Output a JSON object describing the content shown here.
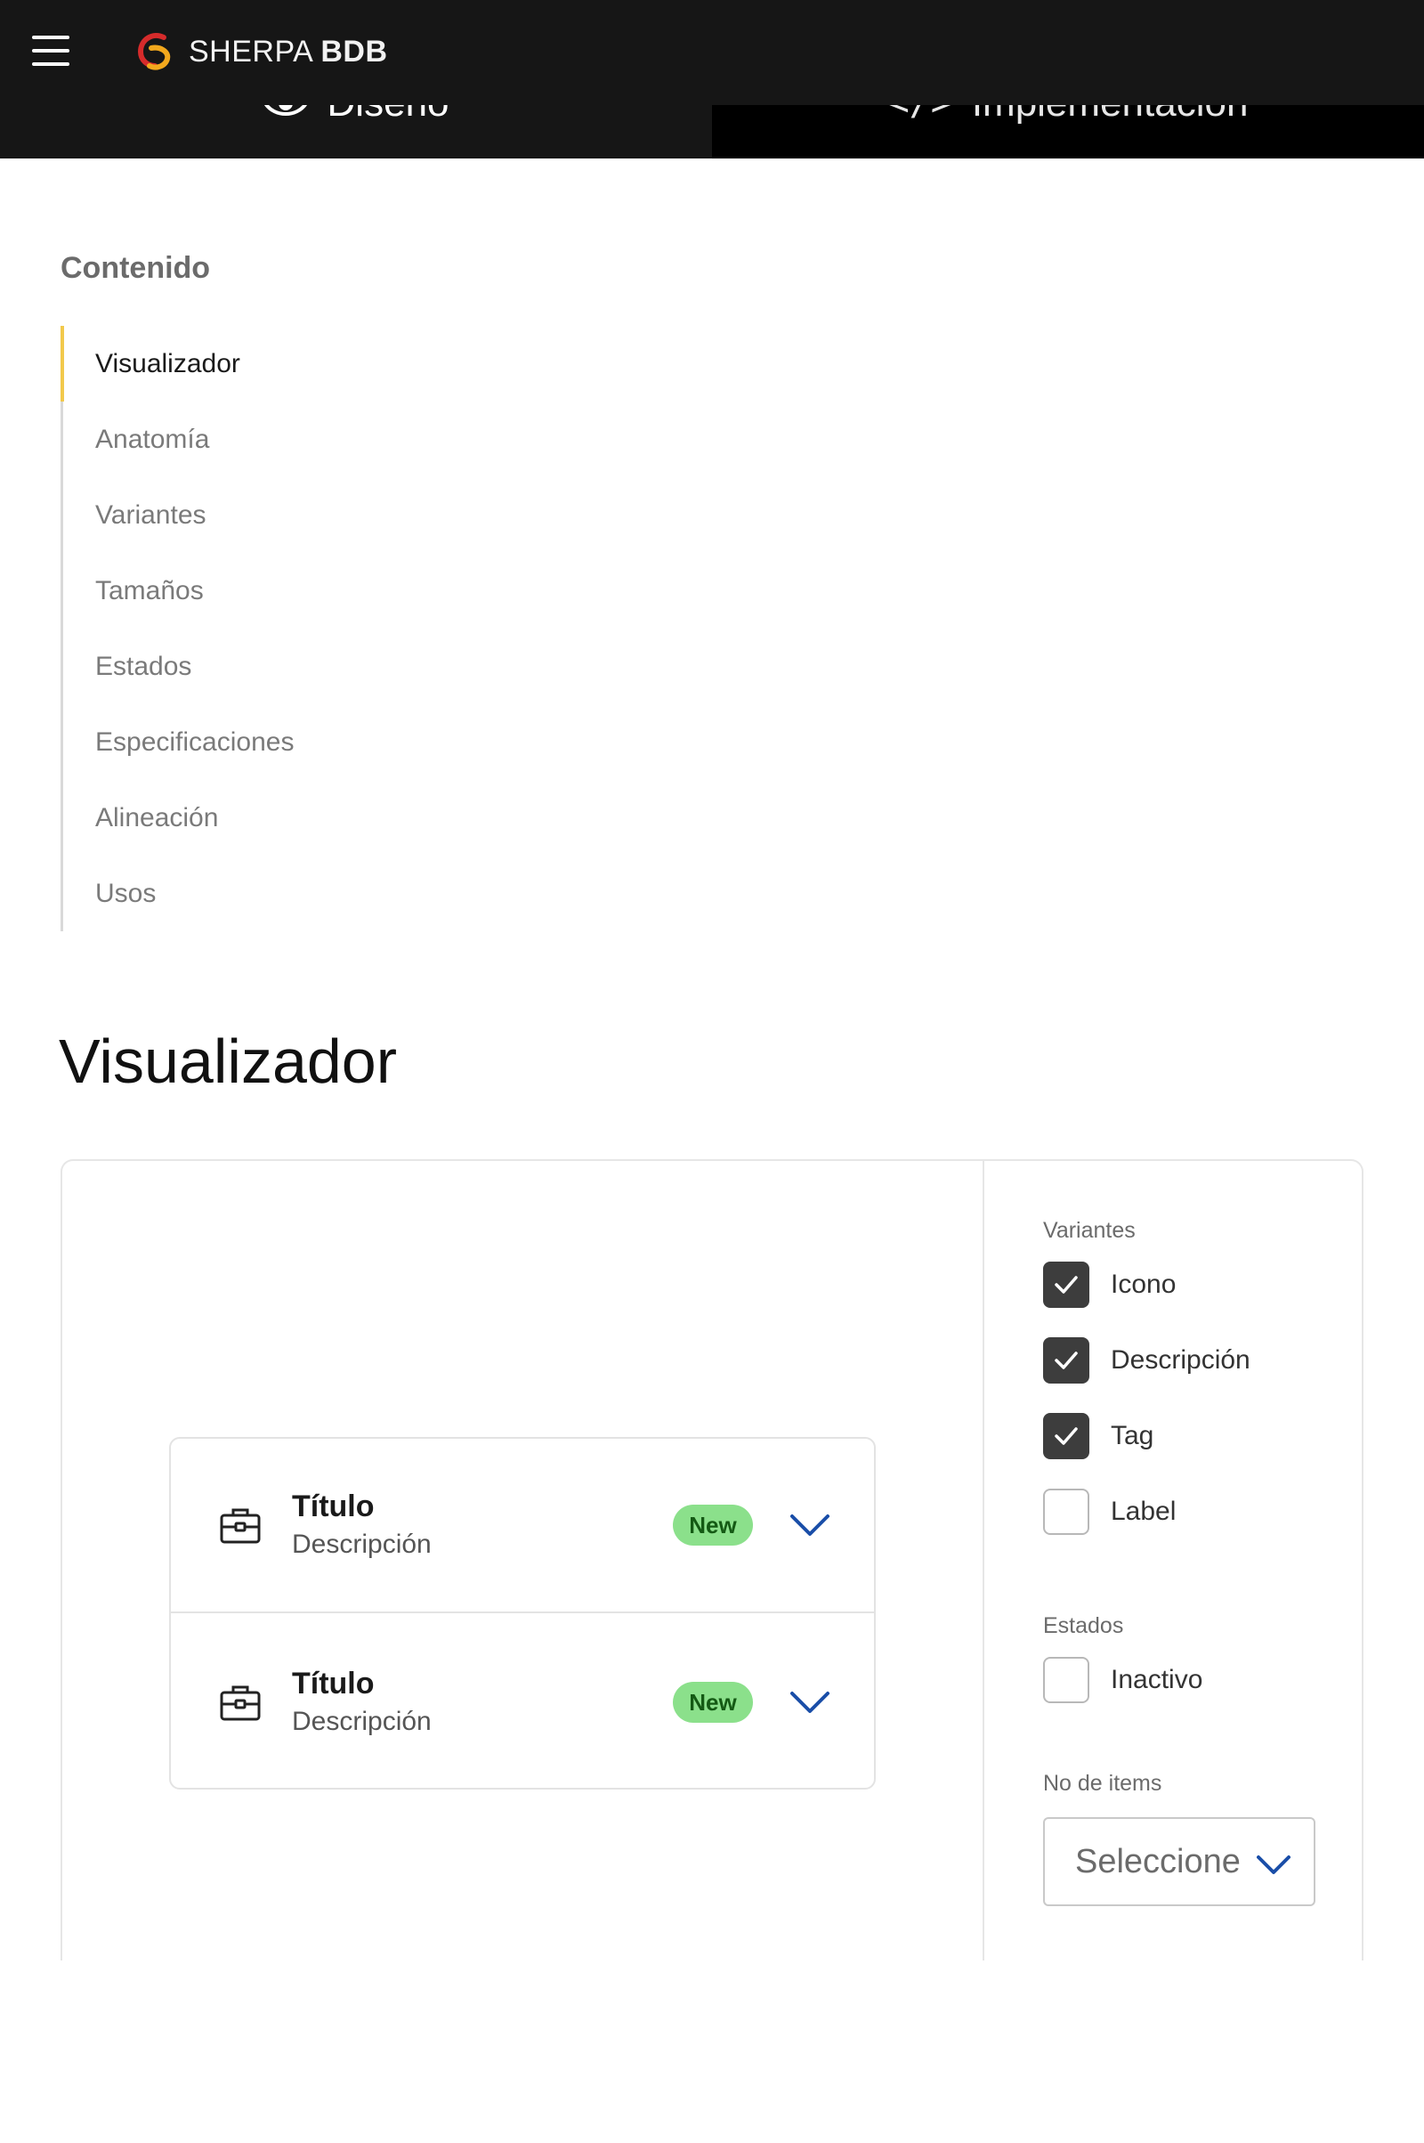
{
  "header": {
    "brand_light": "SHERPA",
    "brand_bold": "BDB"
  },
  "tabs": [
    {
      "label": "Diseño",
      "icon": "eye-icon"
    },
    {
      "label": "Implementación",
      "icon": "code-icon"
    }
  ],
  "toc": {
    "title": "Contenido",
    "items": [
      "Visualizador",
      "Anatomía",
      "Variantes",
      "Tamaños",
      "Estados",
      "Especificaciones",
      "Alineación",
      "Usos"
    ],
    "active_index": 0
  },
  "section": {
    "title": "Visualizador"
  },
  "accordion": {
    "items": [
      {
        "title": "Título",
        "description": "Descripción",
        "tag": "New",
        "icon": "briefcase-icon"
      },
      {
        "title": "Título",
        "description": "Descripción",
        "tag": "New",
        "icon": "briefcase-icon"
      }
    ]
  },
  "controls": {
    "variants_label": "Variantes",
    "variants": [
      {
        "label": "Icono",
        "checked": true
      },
      {
        "label": "Descripción",
        "checked": true
      },
      {
        "label": "Tag",
        "checked": true
      },
      {
        "label": "Label",
        "checked": false
      }
    ],
    "states_label": "Estados",
    "states": [
      {
        "label": "Inactivo",
        "checked": false
      }
    ],
    "items_label": "No de items",
    "items_select": "Seleccione"
  },
  "colors": {
    "header_bg": "#161616",
    "toc_active_accent": "#f2c94c",
    "tag_bg": "#8be08b",
    "tag_text": "#145a14",
    "chevron": "#1a4ea8",
    "checkbox_checked": "#3d3d3d"
  }
}
